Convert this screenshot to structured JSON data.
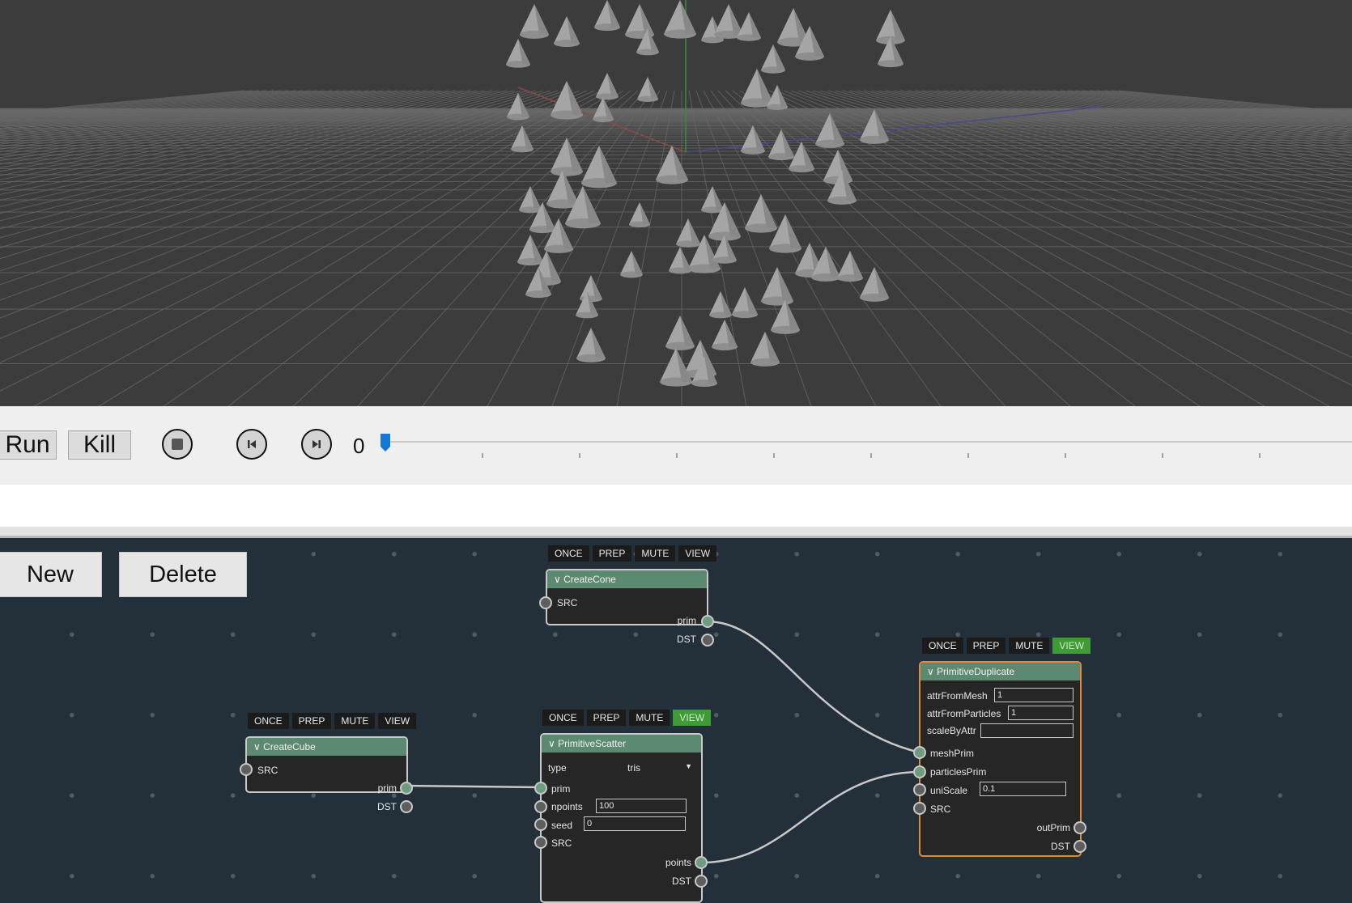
{
  "viewport": {
    "background": "#3c3c3c",
    "grid_color": "#6a6a6a",
    "cone_color": "#a5a5a5"
  },
  "transport": {
    "run_label": "Run",
    "kill_label": "Kill",
    "icons": {
      "stop": "stop-icon",
      "prev": "skip-back-icon",
      "next": "skip-forward-icon"
    },
    "frame_value": "0",
    "accent": "#1677d2"
  },
  "graph": {
    "new_label": "New",
    "delete_label": "Delete",
    "flag_labels": {
      "once": "ONCE",
      "prep": "PREP",
      "mute": "MUTE",
      "view": "VIEW"
    },
    "nodes": {
      "create_cone": {
        "title": "CreateCone",
        "pins": {
          "src": "SRC",
          "prim": "prim",
          "dst": "DST"
        },
        "view_active": false
      },
      "create_cube": {
        "title": "CreateCube",
        "pins": {
          "src": "SRC",
          "prim": "prim",
          "dst": "DST"
        },
        "view_active": false
      },
      "primitive_scatter": {
        "title": "PrimitiveScatter",
        "type_label": "type",
        "type_value": "tris",
        "pins": {
          "prim": "prim",
          "npoints": "npoints",
          "seed": "seed",
          "src": "SRC",
          "points": "points",
          "dst": "DST"
        },
        "npoints_value": "100",
        "seed_value": "0",
        "view_active": true
      },
      "primitive_duplicate": {
        "title": "PrimitiveDuplicate",
        "attr_from_mesh_label": "attrFromMesh",
        "attr_from_mesh_value": "1",
        "attr_from_particles_label": "attrFromParticles",
        "attr_from_particles_value": "1",
        "scale_by_attr_label": "scaleByAttr",
        "scale_by_attr_value": "",
        "pins": {
          "mesh_prim": "meshPrim",
          "particles_prim": "particlesPrim",
          "uni_scale": "uniScale",
          "src": "SRC",
          "out_prim": "outPrim",
          "dst": "DST"
        },
        "uni_scale_value": "0.1",
        "view_active": true,
        "selected": true
      }
    }
  }
}
